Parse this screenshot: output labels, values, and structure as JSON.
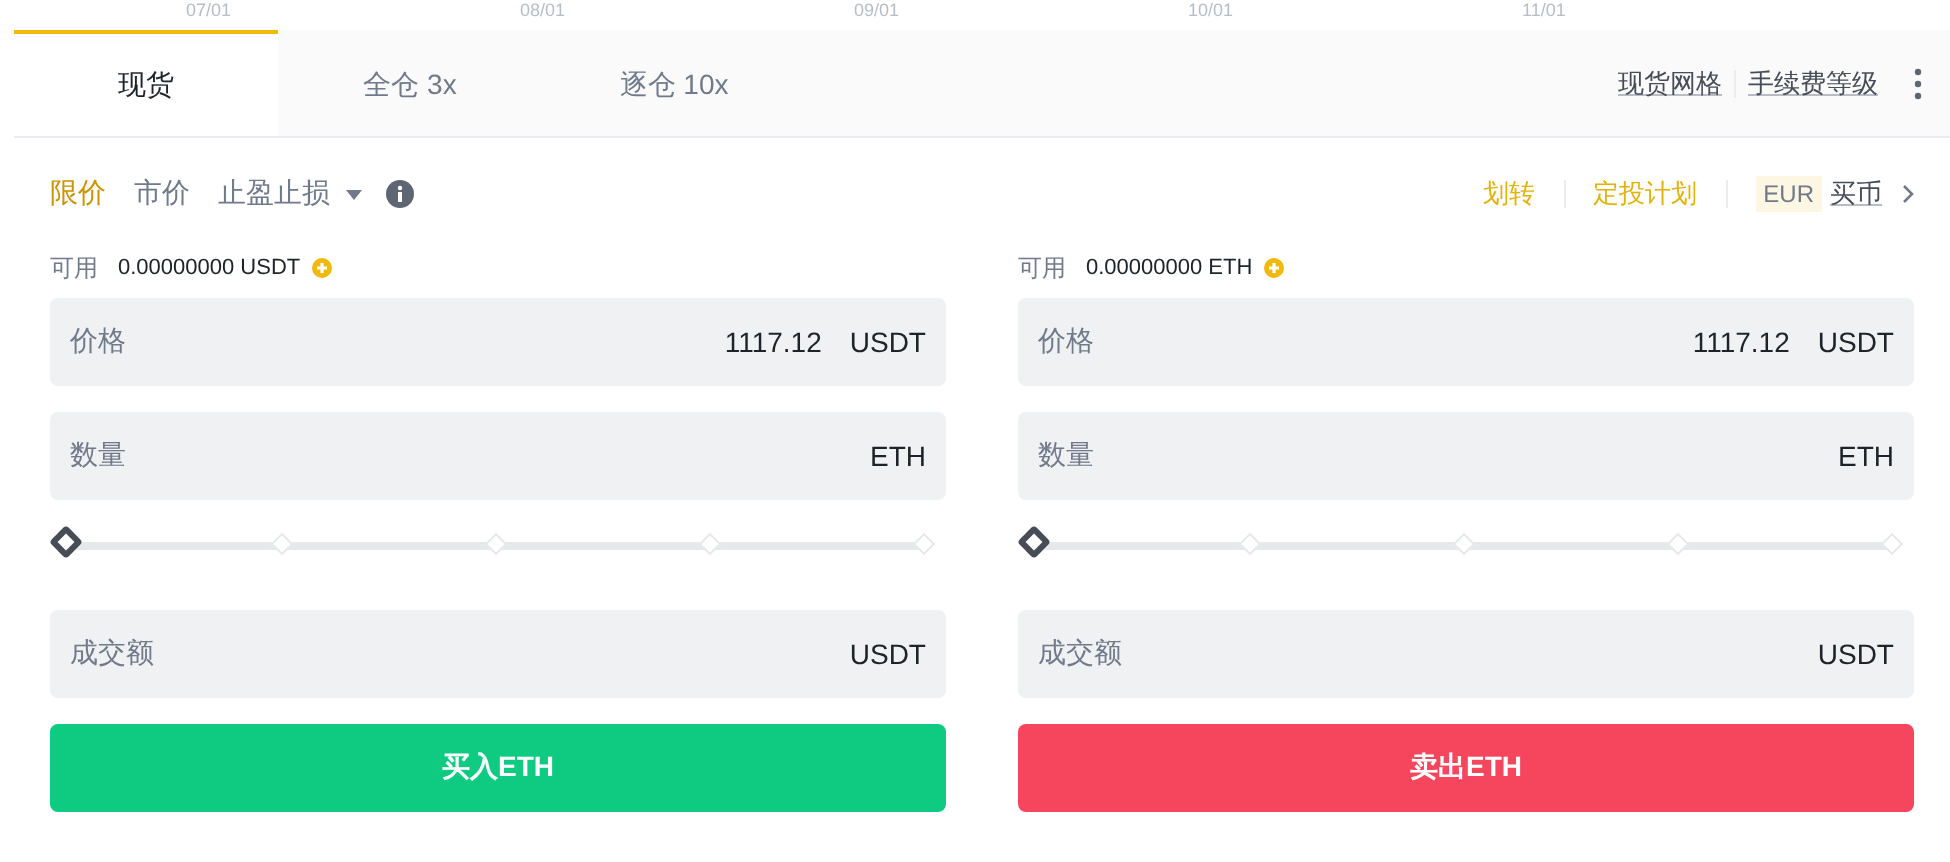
{
  "chart_axis": {
    "labels": [
      "07/01",
      "08/01",
      "09/01",
      "10/01",
      "11/01"
    ]
  },
  "tabs": [
    {
      "label": "现货",
      "selected": true
    },
    {
      "label": "全仓 3x",
      "selected": false
    },
    {
      "label": "逐仓 10x",
      "selected": false
    }
  ],
  "tab_links": [
    "现货网格",
    "手续费等级"
  ],
  "order_types": [
    {
      "label": "限价",
      "selected": true,
      "dropdown": false
    },
    {
      "label": "市价",
      "selected": false,
      "dropdown": false
    },
    {
      "label": "止盈止损",
      "selected": false,
      "dropdown": true
    }
  ],
  "actions": {
    "links": [
      "划转",
      "定投计划"
    ],
    "currency_badge": "EUR",
    "buy_link": "买币"
  },
  "sides": [
    {
      "kind": "buy",
      "available_label": "可用",
      "available": "0.00000000 USDT",
      "fields": [
        {
          "label": "价格",
          "value": "1117.12",
          "unit": "USDT"
        },
        {
          "label": "数量",
          "unit": "ETH"
        }
      ],
      "slider": {
        "level": 0
      },
      "total": {
        "label": "成交额",
        "unit": "USDT"
      },
      "button": "买入ETH"
    },
    {
      "kind": "sell",
      "available_label": "可用",
      "available": "0.00000000 ETH",
      "fields": [
        {
          "label": "价格",
          "value": "1117.12",
          "unit": "USDT"
        },
        {
          "label": "数量",
          "unit": "ETH"
        }
      ],
      "slider": {
        "level": 0
      },
      "total": {
        "label": "成交额",
        "unit": "USDT"
      },
      "button": "卖出ETH"
    }
  ]
}
